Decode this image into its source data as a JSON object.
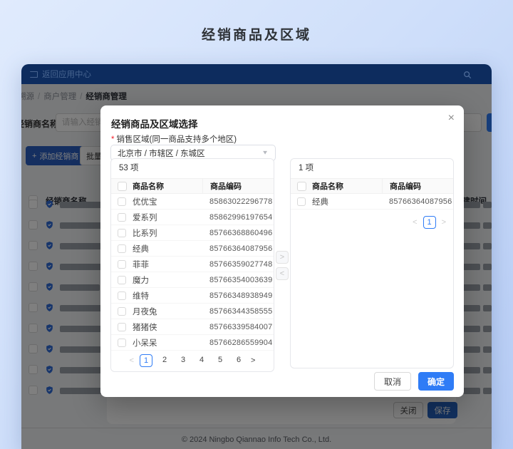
{
  "page": {
    "title": "经销商品及区域",
    "footer": "© 2024 Ningbo Qiannao Info Tech Co., Ltd."
  },
  "app": {
    "header": {
      "back_label": "返回应用中心"
    },
    "breadcrumb": {
      "items": [
        "溯源",
        "商户管理",
        "经销商管理"
      ],
      "separator": "/"
    },
    "filter": {
      "label": "经销商名称:",
      "placeholder": "请输入经销商名称"
    },
    "toolbar": {
      "add_icon": "+",
      "add_button": "添加经销商",
      "batch_button": "批量上传"
    },
    "table": {
      "name_header": "经销商名称",
      "time_header": "创建时间",
      "redacted_rows": 10
    },
    "panel_buttons": {
      "close": "关闭",
      "save": "保存"
    }
  },
  "modal": {
    "title": "经销商品及区域选择",
    "close_icon": "×",
    "region": {
      "required_mark": "*",
      "label": "销售区域(同一商品支持多个地区)",
      "value": "北京市 / 市辖区 / 东城区"
    },
    "source_panel": {
      "count": "53 项",
      "columns": {
        "name": "商品名称",
        "code": "商品编码"
      },
      "rows": [
        {
          "name": "优优宝",
          "code": "85863022296778"
        },
        {
          "name": "爱系列",
          "code": "85862996197654"
        },
        {
          "name": "比系列",
          "code": "85766368860496"
        },
        {
          "name": "经典",
          "code": "85766364087956"
        },
        {
          "name": "菲菲",
          "code": "85766359027748"
        },
        {
          "name": "魔力",
          "code": "85766354003639"
        },
        {
          "name": "维特",
          "code": "85766348938949"
        },
        {
          "name": "月夜兔",
          "code": "85766344358555"
        },
        {
          "name": "猪猪侠",
          "code": "85766339584007"
        },
        {
          "name": "小呆呆",
          "code": "85766286559904"
        }
      ],
      "pagination": {
        "pages": [
          "1",
          "2",
          "3",
          "4",
          "5",
          "6"
        ],
        "active": "1",
        "prev": "<",
        "next": ">",
        "prev_disabled": true,
        "next_disabled": false
      }
    },
    "transfer": {
      "to_right": ">",
      "to_left": "<"
    },
    "target_panel": {
      "count": "1 项",
      "columns": {
        "name": "商品名称",
        "code": "商品编码"
      },
      "rows": [
        {
          "name": "经典",
          "code": "85766364087956"
        }
      ],
      "pagination": {
        "pages": [
          "1"
        ],
        "active": "1",
        "prev": "<",
        "next": ">",
        "prev_disabled": true,
        "next_disabled": true
      }
    },
    "footer": {
      "cancel": "取消",
      "confirm": "确定"
    }
  },
  "colors": {
    "accent": "#2f7cf6",
    "header_navy": "#0d2c5e",
    "save_blue": "#2563c0",
    "shield_blue": "#2e6bd6",
    "required_red": "#f5222d"
  }
}
